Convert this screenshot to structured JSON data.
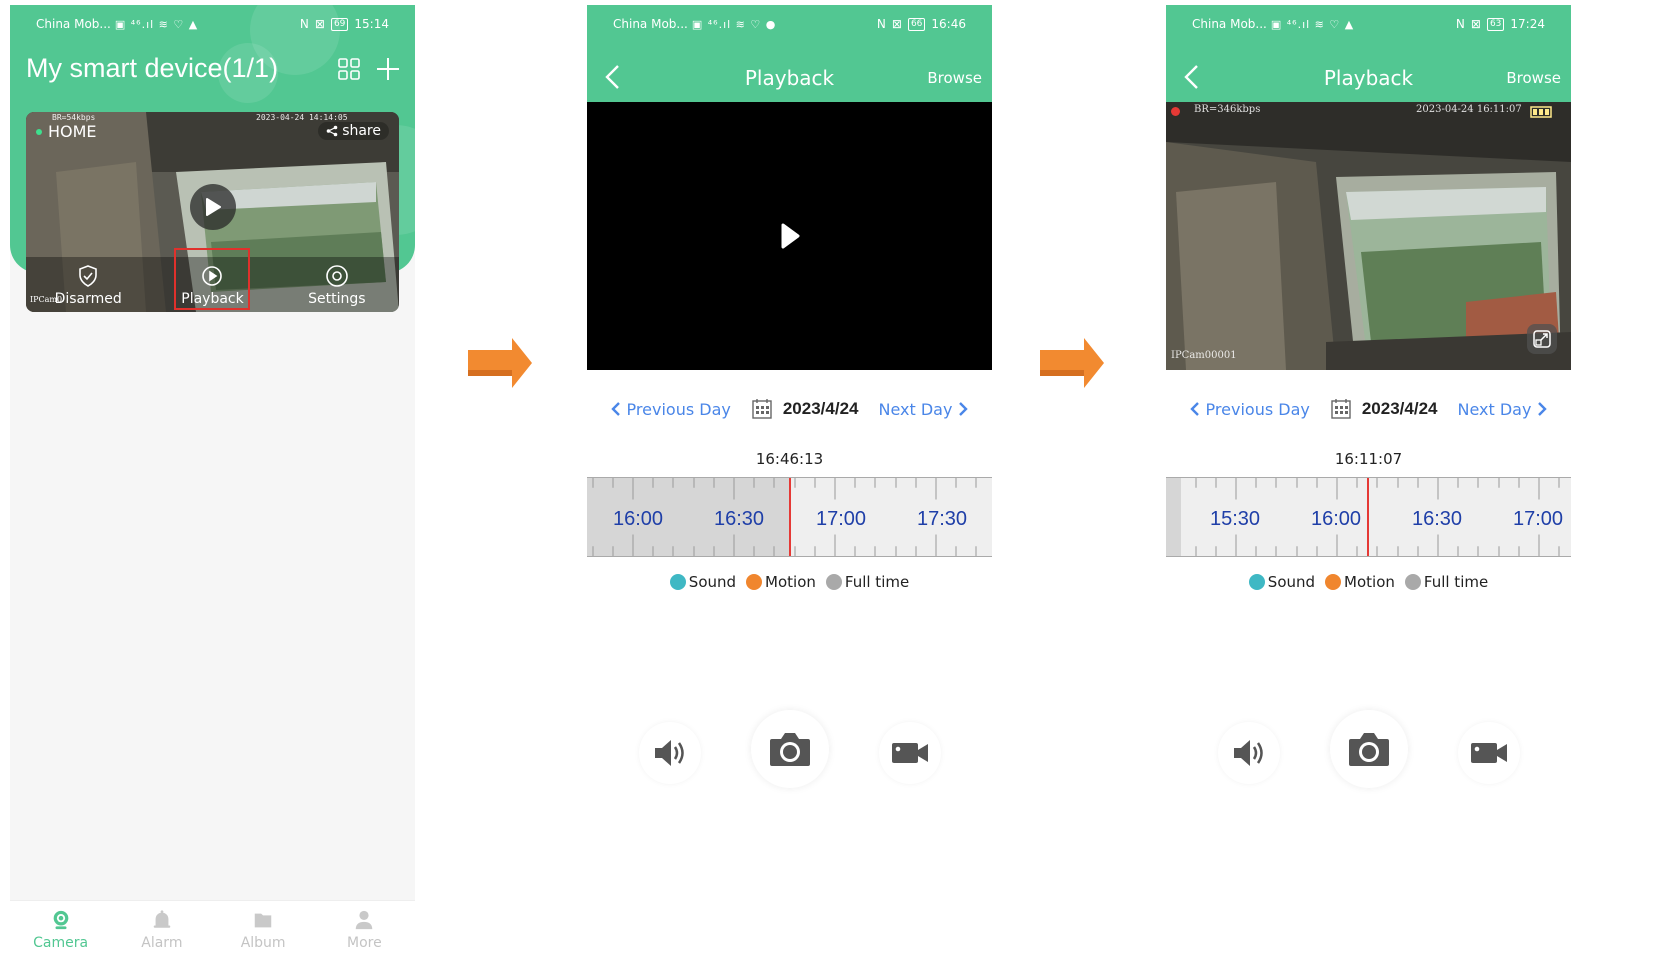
{
  "screen1": {
    "status": {
      "carrier": "China Mob...",
      "icons": "▣ ⁴⁶.ıl ≋ ♡ ▲",
      "nfc": "N",
      "silent": "⊠",
      "battery": "69",
      "time": "15:14"
    },
    "title": "My smart device(1/1)",
    "icons": {
      "grid": "grid-icon",
      "add": "plus-icon"
    },
    "card": {
      "osd_bitrate": "BR=54kbps",
      "osd_datetime": "2023-04-24 14:14:05",
      "osd_camera": "IPCam0",
      "device_name": "HOME",
      "share_label": "share",
      "actions": [
        {
          "label": "Disarmed",
          "icon": "shield-check-icon"
        },
        {
          "label": "Playback",
          "icon": "playback-icon"
        },
        {
          "label": "Settings",
          "icon": "settings-icon"
        }
      ]
    },
    "tabs": [
      {
        "label": "Camera",
        "icon": "camera-tab-icon",
        "active": true
      },
      {
        "label": "Alarm",
        "icon": "bell-icon",
        "active": false
      },
      {
        "label": "Album",
        "icon": "folder-icon",
        "active": false
      },
      {
        "label": "More",
        "icon": "user-icon",
        "active": false
      }
    ]
  },
  "screen2": {
    "status": {
      "carrier": "China Mob...",
      "icons": "▣ ⁴⁶.ıl ≋ ♡ ●",
      "nfc": "N",
      "silent": "⊠",
      "battery": "66",
      "time": "16:46"
    },
    "title": "Playback",
    "browse": "Browse",
    "prev_day": "Previous Day",
    "date": "2023/4/24",
    "next_day": "Next Day",
    "current_time": "16:46:13",
    "timeline_labels": [
      "16:00",
      "16:30",
      "17:00",
      "17:30"
    ],
    "legend": [
      {
        "label": "Sound",
        "color": "#3fb8c4"
      },
      {
        "label": "Motion",
        "color": "#f0862e"
      },
      {
        "label": "Full time",
        "color": "#a9a9a9"
      }
    ]
  },
  "screen3": {
    "status": {
      "carrier": "China Mob...",
      "icons": "▣ ⁴⁶.ıl ≋ ♡ ▲",
      "nfc": "N",
      "silent": "⊠",
      "battery": "63",
      "time": "17:24"
    },
    "title": "Playback",
    "browse": "Browse",
    "osd_bitrate": "BR=346kbps",
    "osd_datetime": "2023-04-24 16:11:07",
    "osd_camera": "IPCam00001",
    "prev_day": "Previous Day",
    "date": "2023/4/24",
    "next_day": "Next Day",
    "current_time": "16:11:07",
    "timeline_labels": [
      "15:30",
      "16:00",
      "16:30",
      "17:00"
    ],
    "legend": [
      {
        "label": "Sound",
        "color": "#3fb8c4"
      },
      {
        "label": "Motion",
        "color": "#f0862e"
      },
      {
        "label": "Full time",
        "color": "#a9a9a9"
      }
    ]
  },
  "colors": {
    "brand": "#52c792",
    "link": "#4a86e8",
    "timeline_text": "#1f3fa8",
    "cursor": "#e53935",
    "arrow": "#f28a30",
    "highlight": "#e0312c"
  }
}
